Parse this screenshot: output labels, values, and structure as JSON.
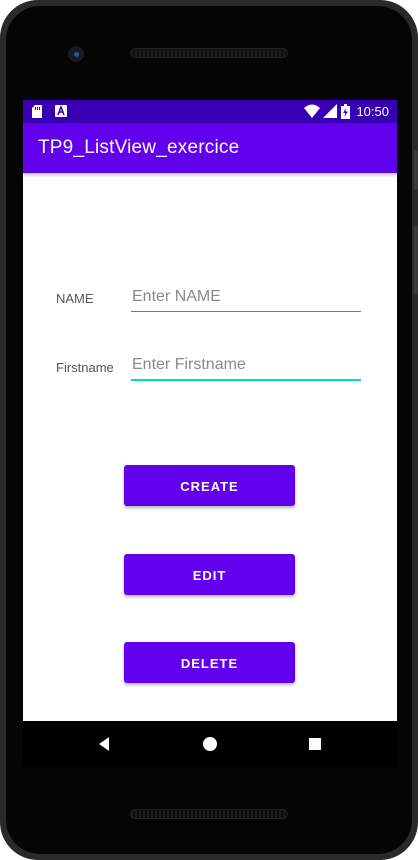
{
  "status_bar": {
    "time": "10:50",
    "icons": [
      "sd-card-icon",
      "a-notification-icon",
      "wifi-icon",
      "signal-icon",
      "battery-charging-icon"
    ]
  },
  "app_bar": {
    "title": "TP9_ListView_exercice"
  },
  "form": {
    "name_label": "NAME",
    "name_placeholder": "Enter NAME",
    "name_value": "",
    "firstname_label": "Firstname",
    "firstname_placeholder": "Enter Firstname",
    "firstname_value": ""
  },
  "buttons": {
    "create": "CREATE",
    "edit": "EDIT",
    "delete": "DELETE"
  },
  "nav_bar": {
    "icons": [
      "back-icon",
      "home-icon",
      "recents-icon"
    ]
  },
  "colors": {
    "status_bar": "#3700b3",
    "primary": "#6200ee",
    "accent": "#03dac5"
  }
}
